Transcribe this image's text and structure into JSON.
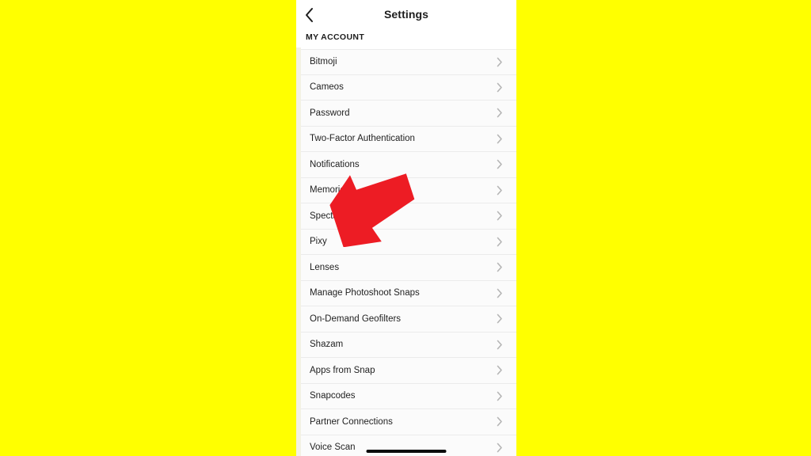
{
  "background": {
    "color": "#FFFF00"
  },
  "phone": {
    "screen_bg": "#ffffff",
    "row_bg": "#fbfbfb",
    "divider_color": "#ebebeb"
  },
  "nav": {
    "back_icon": "chevron-left-icon",
    "title": "Settings"
  },
  "section": {
    "header": "MY ACCOUNT"
  },
  "list": {
    "chevron_icon": "chevron-right-icon",
    "items": [
      {
        "label": "Bitmoji"
      },
      {
        "label": "Cameos"
      },
      {
        "label": "Password"
      },
      {
        "label": "Two-Factor Authentication"
      },
      {
        "label": "Notifications"
      },
      {
        "label": "Memories"
      },
      {
        "label": "Spectacles"
      },
      {
        "label": "Pixy"
      },
      {
        "label": "Lenses"
      },
      {
        "label": "Manage Photoshoot Snaps"
      },
      {
        "label": "On-Demand Geofilters"
      },
      {
        "label": "Shazam"
      },
      {
        "label": "Apps from Snap"
      },
      {
        "label": "Snapcodes"
      },
      {
        "label": "Partner Connections"
      },
      {
        "label": "Voice Scan"
      }
    ]
  },
  "annotation": {
    "arrow_icon": "red-pointer-arrow-icon",
    "arrow_color": "#ED1C24",
    "points_at": "Notifications"
  },
  "home_indicator": {
    "color": "#0b0b0b"
  }
}
